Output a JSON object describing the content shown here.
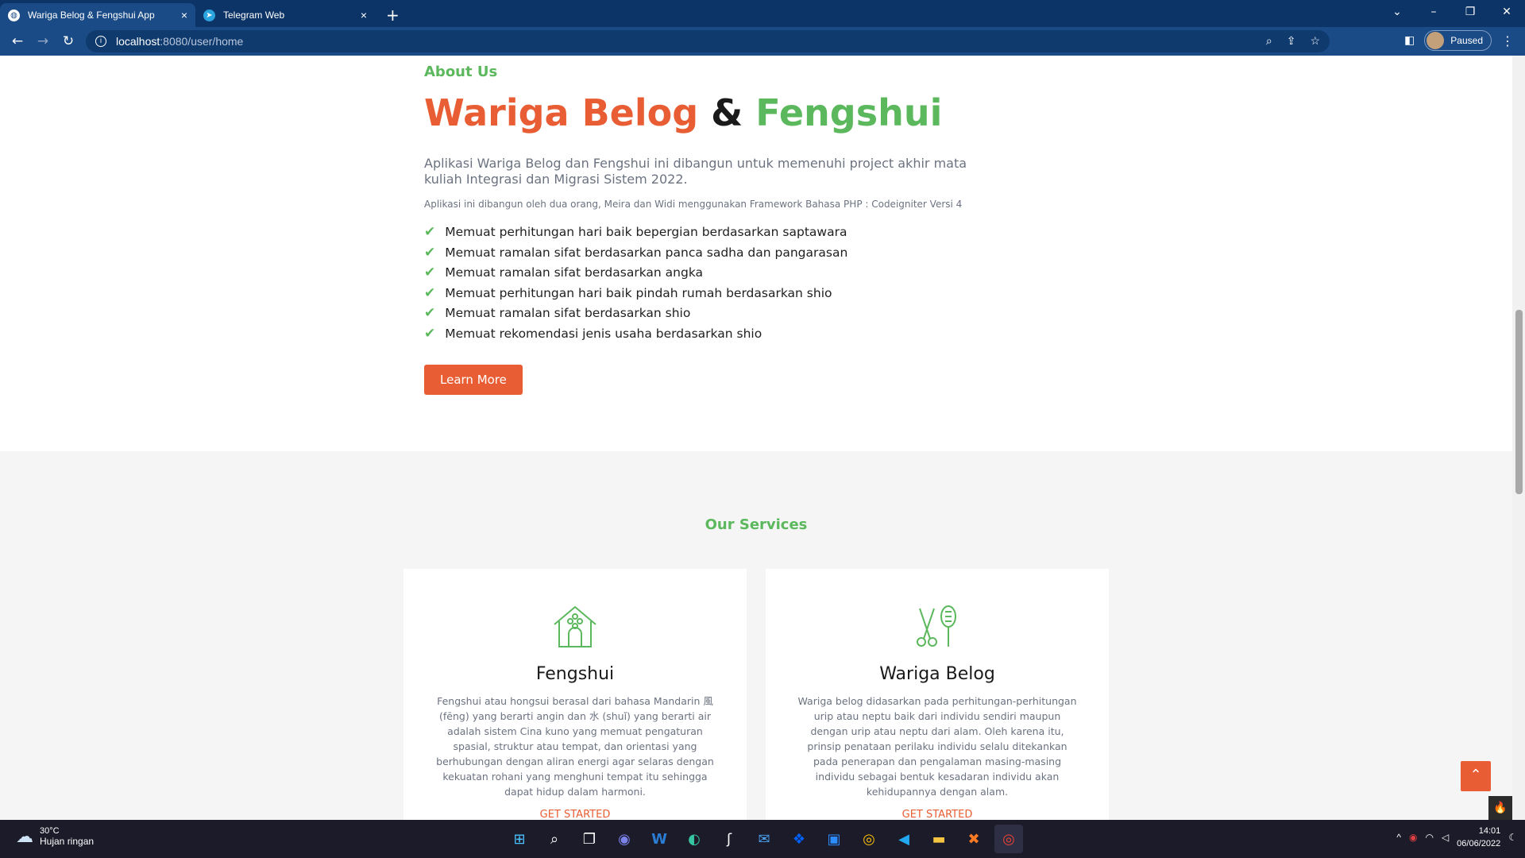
{
  "browser": {
    "tabs": [
      {
        "title": "Wariga Belog & Fengshui App",
        "icon": "globe-icon"
      },
      {
        "title": "Telegram Web",
        "icon": "telegram-icon"
      }
    ],
    "new_tab": "+",
    "close_glyph": "×",
    "url_host": "localhost",
    "url_path": ":8080/user/home",
    "profile_status": "Paused"
  },
  "about": {
    "eyebrow": "About Us",
    "title_part1": "Wariga Belog",
    "title_amp": "&",
    "title_part2": "Fengshui",
    "lead": "Aplikasi Wariga Belog dan Fengshui ini dibangun untuk memenuhi project akhir mata kuliah Integrasi dan Migrasi Sistem 2022.",
    "small": "Aplikasi ini dibangun oleh dua orang, Meira dan Widi menggunakan Framework Bahasa PHP : Codeigniter Versi 4",
    "features": [
      "Memuat perhitungan hari baik bepergian berdasarkan saptawara",
      "Memuat ramalan sifat berdasarkan panca sadha dan pangarasan",
      "Memuat ramalan sifat berdasarkan angka",
      "Memuat perhitungan hari baik pindah rumah berdasarkan shio",
      "Memuat ramalan sifat berdasarkan shio",
      "Memuat rekomendasi jenis usaha berdasarkan shio"
    ],
    "learn_more": "Learn More"
  },
  "services": {
    "title": "Our Services",
    "cards": [
      {
        "title": "Fengshui",
        "icon": "house-icon",
        "text": "Fengshui atau hongsui berasal dari bahasa Mandarin 風 (fēng) yang berarti angin dan 水 (shuǐ) yang berarti air adalah sistem Cina kuno yang memuat pengaturan spasial, struktur atau tempat, dan orientasi yang berhubungan dengan aliran energi agar selaras dengan kekuatan rohani yang menghuni tempat itu sehingga dapat hidup dalam harmoni.",
        "cta": "GET STARTED"
      },
      {
        "title": "Wariga Belog",
        "icon": "scissors-brush-icon",
        "text": "Wariga belog didasarkan pada perhitungan-perhitungan urip atau neptu baik dari individu sendiri maupun dengan urip atau neptu dari alam. Oleh karena itu, prinsip penataan perilaku individu selalu ditekankan pada penerapan dan pengalaman masing-masing individu sebagai bentuk kesadaran individu akan kehidupannya dengan alam.",
        "cta": "GET STARTED"
      }
    ]
  },
  "taskbar": {
    "weather_temp": "30°C",
    "weather_desc": "Hujan ringan",
    "time": "14:01",
    "date": "06/06/2022"
  },
  "colors": {
    "accent_orange": "#e85d33",
    "accent_green": "#5cb85c",
    "chrome_blue": "#1a4b86"
  }
}
